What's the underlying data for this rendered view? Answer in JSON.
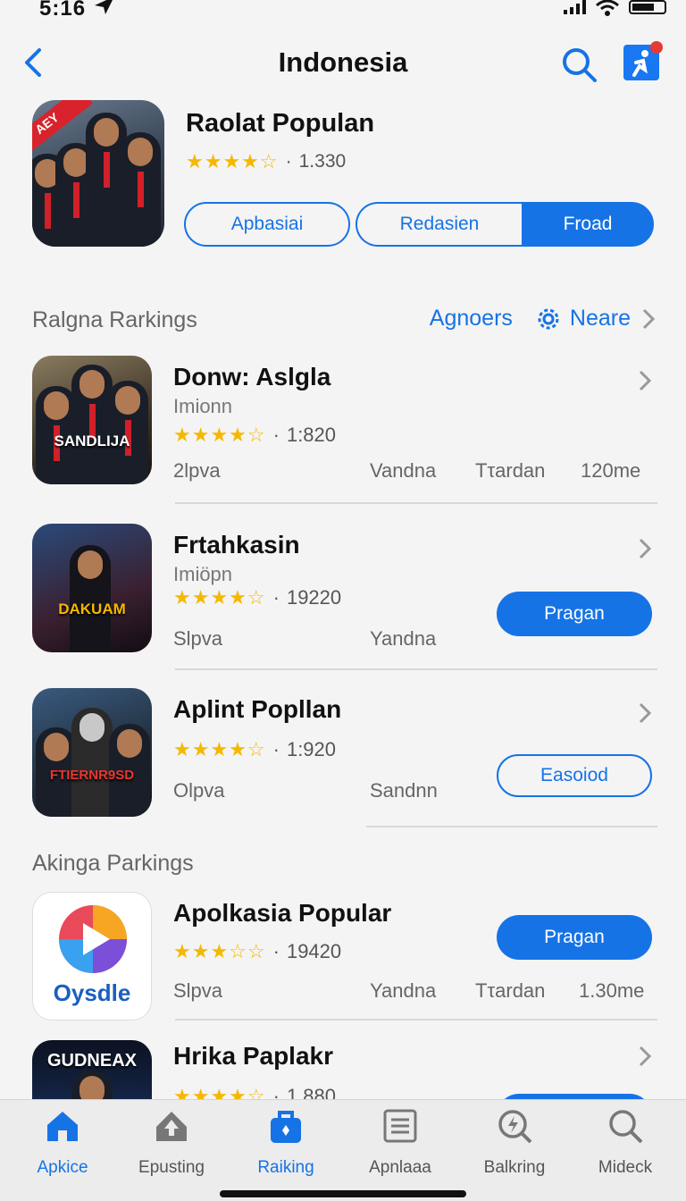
{
  "status": {
    "time": "5:16"
  },
  "nav": {
    "title": "Indonesia"
  },
  "hero": {
    "icon_badge": "AEY",
    "title": "Raolat Populan",
    "stars": "★★★★☆",
    "rating_count": "1.330",
    "tabs": [
      "Apbasiai",
      "Redasien",
      "Froad"
    ]
  },
  "section1": {
    "title": "Ralgna Rarkings",
    "action1": "Agnoers",
    "action2": "Neare"
  },
  "section2": {
    "title": "Akinga Parkings"
  },
  "apps": [
    {
      "icon_text": "SANDLIJA",
      "title": "Donw: Aslgla",
      "subtitle": "Imionn",
      "stars": "★★★★☆",
      "rating": "1:820",
      "meta": [
        "2lpva",
        "Vandna",
        "Tτardan",
        "120me"
      ]
    },
    {
      "icon_text": "DAKUAM",
      "title": "Frtahkasin",
      "subtitle": "Imiöpn",
      "stars": "★★★★☆",
      "rating": "19220",
      "meta": [
        "Slpva",
        "Yandna"
      ],
      "button": "Pragan"
    },
    {
      "icon_text": "FTIERNR9SD",
      "title": "Aplint Popllan",
      "stars": "★★★★☆",
      "rating": "1:920",
      "meta": [
        "Olpva",
        "Sandnn"
      ],
      "button": "Easoiod"
    },
    {
      "icon_text": "Oysdle",
      "title": "Apolkasia Popular",
      "stars": "★★★☆☆",
      "rating": "19420",
      "meta": [
        "Slpva",
        "Yandna",
        "Tτardan",
        "1.30me"
      ],
      "button": "Pragan"
    },
    {
      "icon_text": "GUDNEAX",
      "title": "Hrika Paplakr",
      "stars": "★★★★☆",
      "rating": "1.880"
    }
  ],
  "tabs": [
    {
      "label": "Apkice",
      "icon": "home-icon",
      "active": true
    },
    {
      "label": "Epusting",
      "icon": "upload-icon"
    },
    {
      "label": "Raiking",
      "icon": "bag-icon",
      "active": true
    },
    {
      "label": "Apnlaaa",
      "icon": "list-icon"
    },
    {
      "label": "Balkring",
      "icon": "magnify-bolt-icon"
    },
    {
      "label": "Mideck",
      "icon": "search-icon"
    }
  ],
  "colors": {
    "accent": "#1673e6",
    "star": "#f5b800"
  }
}
